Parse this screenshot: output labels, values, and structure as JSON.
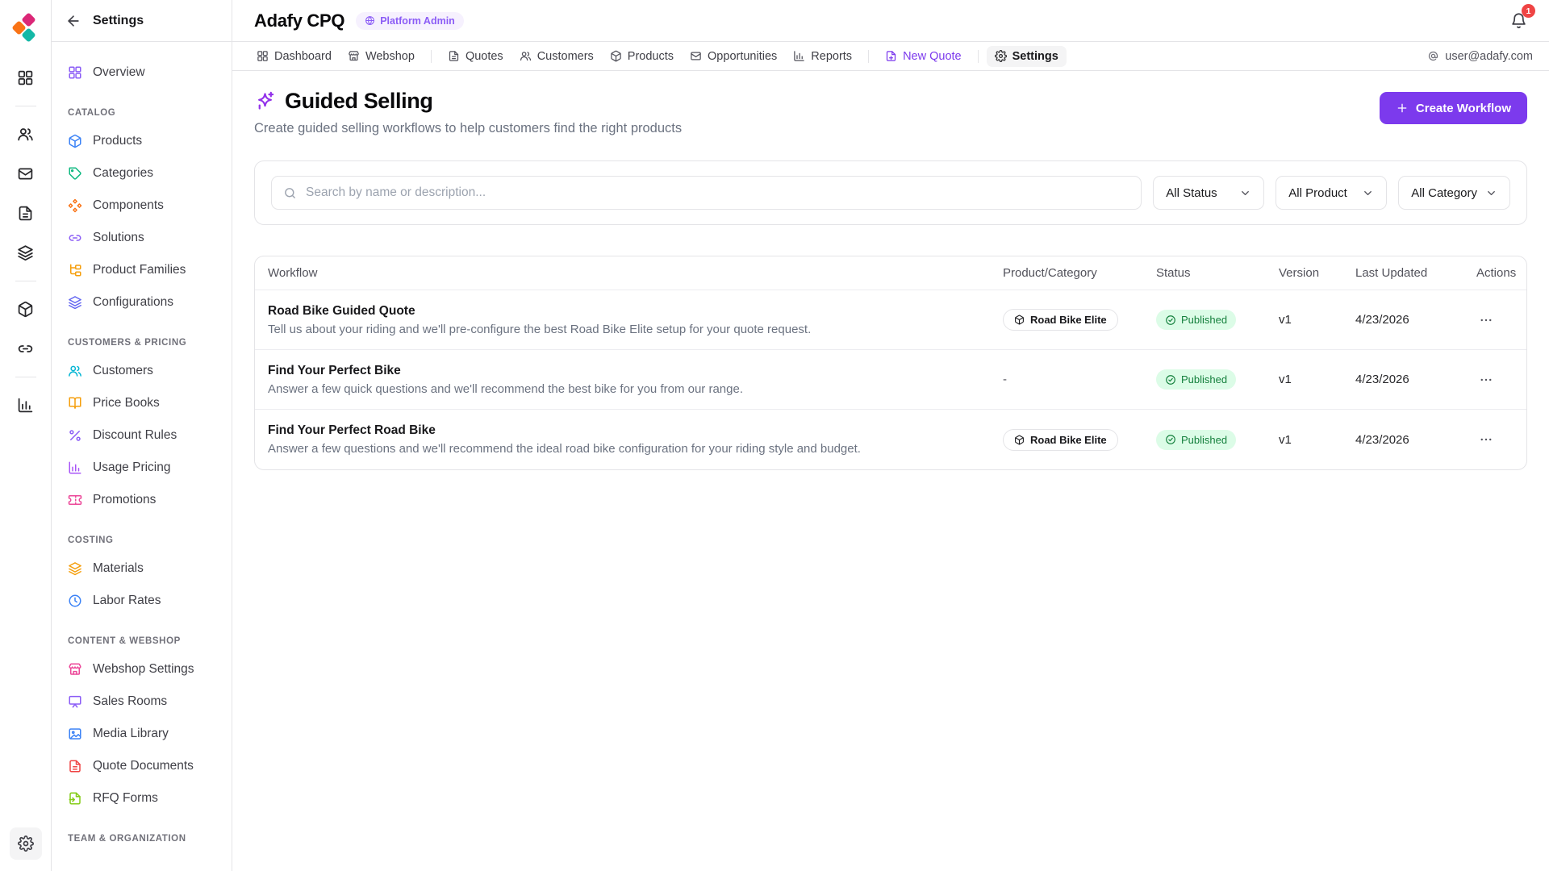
{
  "colors": {
    "accent": "#7c3aed",
    "notification_badge": "#ef4444",
    "status_published_bg": "#dcfce7",
    "status_published_text": "#15803d",
    "logo_orange": "#f97316",
    "logo_pink": "#db2777",
    "logo_teal": "#14b8a6"
  },
  "rail": {
    "items": [
      {
        "icon": "grid",
        "divider_before": false
      },
      {
        "icon": "users",
        "divider_before": true
      },
      {
        "icon": "mail",
        "divider_before": false
      },
      {
        "icon": "file-text",
        "divider_before": false
      },
      {
        "icon": "layers",
        "divider_before": false
      },
      {
        "icon": "box",
        "divider_before": true
      },
      {
        "icon": "link",
        "divider_before": false
      },
      {
        "icon": "chart",
        "divider_before": true
      }
    ]
  },
  "sidebar": {
    "title": "Settings",
    "sections": [
      {
        "label": "",
        "items": [
          {
            "label": "Overview",
            "icon": "grid",
            "color": "#8b5cf6"
          }
        ]
      },
      {
        "label": "CATALOG",
        "items": [
          {
            "label": "Products",
            "icon": "box",
            "color": "#3b82f6"
          },
          {
            "label": "Categories",
            "icon": "tag",
            "color": "#10b981"
          },
          {
            "label": "Components",
            "icon": "component",
            "color": "#f97316"
          },
          {
            "label": "Solutions",
            "icon": "link",
            "color": "#8b5cf6"
          },
          {
            "label": "Product Families",
            "icon": "tree",
            "color": "#f59e0b"
          },
          {
            "label": "Configurations",
            "icon": "layers",
            "color": "#6366f1"
          }
        ]
      },
      {
        "label": "CUSTOMERS & PRICING",
        "items": [
          {
            "label": "Customers",
            "icon": "users",
            "color": "#06b6d4"
          },
          {
            "label": "Price Books",
            "icon": "book",
            "color": "#f59e0b"
          },
          {
            "label": "Discount Rules",
            "icon": "percent",
            "color": "#8b5cf6"
          },
          {
            "label": "Usage Pricing",
            "icon": "chart",
            "color": "#a855f7"
          },
          {
            "label": "Promotions",
            "icon": "ticket",
            "color": "#ec4899"
          }
        ]
      },
      {
        "label": "COSTING",
        "items": [
          {
            "label": "Materials",
            "icon": "layers",
            "color": "#f59e0b"
          },
          {
            "label": "Labor Rates",
            "icon": "clock",
            "color": "#3b82f6"
          }
        ]
      },
      {
        "label": "CONTENT & WEBSHOP",
        "items": [
          {
            "label": "Webshop Settings",
            "icon": "store",
            "color": "#ec4899"
          },
          {
            "label": "Sales Rooms",
            "icon": "presentation",
            "color": "#8b5cf6"
          },
          {
            "label": "Media Library",
            "icon": "image",
            "color": "#3b82f6"
          },
          {
            "label": "Quote Documents",
            "icon": "file-text",
            "color": "#ef4444"
          },
          {
            "label": "RFQ Forms",
            "icon": "file-input",
            "color": "#84cc16"
          }
        ]
      },
      {
        "label": "TEAM & ORGANIZATION",
        "items": []
      }
    ]
  },
  "header": {
    "app_title": "Adafy CPQ",
    "admin_badge": "Platform Admin",
    "notification_count": "1"
  },
  "nav": {
    "tabs": [
      {
        "label": "Dashboard",
        "icon": "grid",
        "variant": "",
        "divider_before": false
      },
      {
        "label": "Webshop",
        "icon": "store",
        "variant": "",
        "divider_before": false
      },
      {
        "label": "Quotes",
        "icon": "file-text",
        "variant": "",
        "divider_before": true
      },
      {
        "label": "Customers",
        "icon": "users",
        "variant": "",
        "divider_before": false
      },
      {
        "label": "Products",
        "icon": "box",
        "variant": "",
        "divider_before": false
      },
      {
        "label": "Opportunities",
        "icon": "mail",
        "variant": "",
        "divider_before": false
      },
      {
        "label": "Reports",
        "icon": "chart",
        "variant": "",
        "divider_before": false
      },
      {
        "label": "New Quote",
        "icon": "file-plus",
        "variant": "accent",
        "divider_before": true
      },
      {
        "label": "Settings",
        "icon": "gear",
        "variant": "active",
        "divider_before": true
      }
    ],
    "user_email": "user@adafy.com"
  },
  "page": {
    "title": "Guided Selling",
    "subtitle": "Create guided selling workflows to help customers find the right products",
    "create_button": "Create Workflow"
  },
  "filters": {
    "search_placeholder": "Search by name or description...",
    "dropdowns": [
      {
        "label": "All Status"
      },
      {
        "label": "All Product"
      },
      {
        "label": "All Category"
      }
    ]
  },
  "table": {
    "columns": [
      "Workflow",
      "Product/Category",
      "Status",
      "Version",
      "Last Updated",
      "Actions"
    ],
    "rows": [
      {
        "name": "Road Bike Guided Quote",
        "description": "Tell us about your riding and we'll pre-configure the best Road Bike Elite setup for your quote request.",
        "product": "Road Bike Elite",
        "status": "Published",
        "version": "v1",
        "last_updated": "4/23/2026"
      },
      {
        "name": "Find Your Perfect Bike",
        "description": "Answer a few quick questions and we'll recommend the best bike for you from our range.",
        "product": "-",
        "status": "Published",
        "version": "v1",
        "last_updated": "4/23/2026"
      },
      {
        "name": "Find Your Perfect Road Bike",
        "description": "Answer a few questions and we'll recommend the ideal road bike configuration for your riding style and budget.",
        "product": "Road Bike Elite",
        "status": "Published",
        "version": "v1",
        "last_updated": "4/23/2026"
      }
    ]
  }
}
